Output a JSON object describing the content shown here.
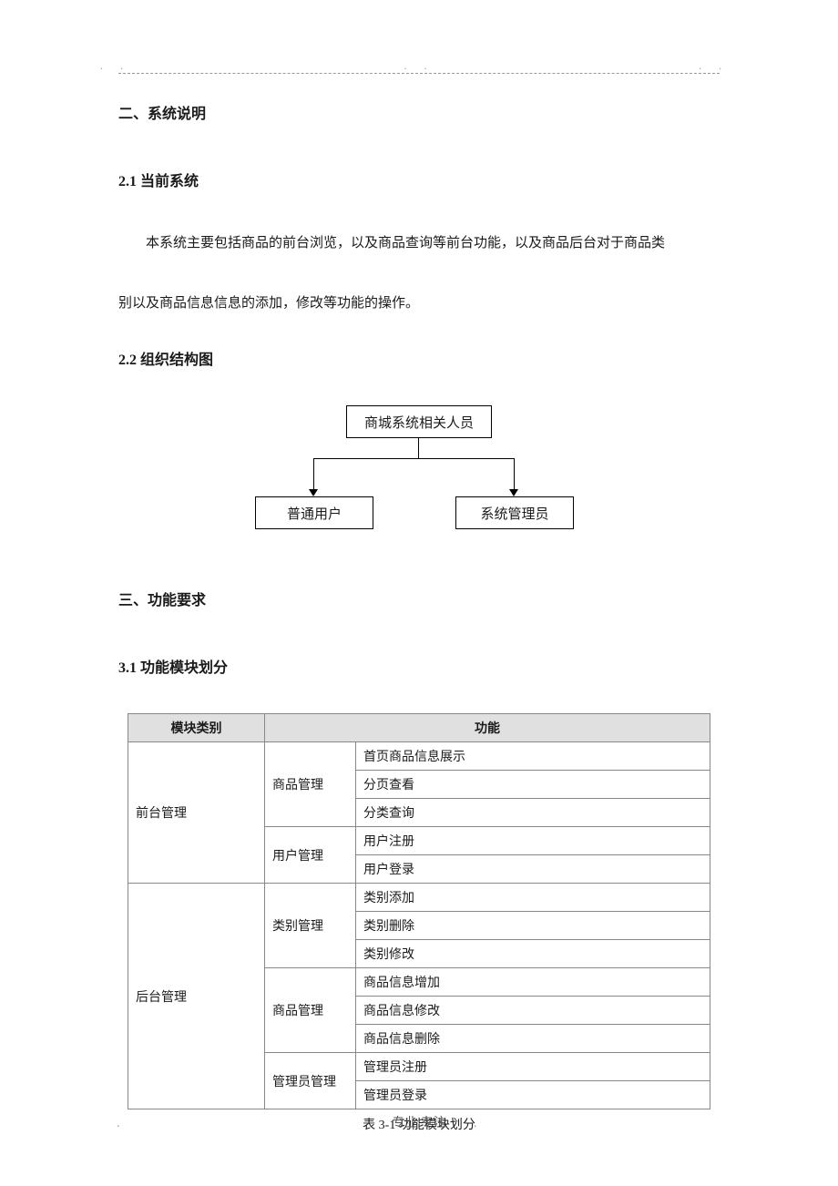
{
  "sections": {
    "s2": "二、系统说明",
    "s21": "2.1 当前系统",
    "s21_p1": "本系统主要包括商品的前台浏览，以及商品查询等前台功能，以及商品后台对于商品类",
    "s21_p2": "别以及商品信息信息的添加，修改等功能的操作。",
    "s22": "2.2 组织结构图",
    "s3": "三、功能要求",
    "s31": "3.1 功能模块划分"
  },
  "org": {
    "top": "商城系统相关人员",
    "left": "普通用户",
    "right": "系统管理员"
  },
  "table": {
    "headers": {
      "module": "模块类别",
      "func": "功能"
    },
    "rows": [
      {
        "module": "前台管理",
        "sub": "商品管理",
        "func": "首页商品信息展示"
      },
      {
        "module": "",
        "sub": "",
        "func": "分页查看"
      },
      {
        "module": "",
        "sub": "",
        "func": "分类查询"
      },
      {
        "module": "",
        "sub": "用户管理",
        "func": "用户注册"
      },
      {
        "module": "",
        "sub": "",
        "func": "用户登录"
      },
      {
        "module": "后台管理",
        "sub": "类别管理",
        "func": "类别添加"
      },
      {
        "module": "",
        "sub": "",
        "func": "类别删除"
      },
      {
        "module": "",
        "sub": "",
        "func": "类别修改"
      },
      {
        "module": "",
        "sub": "商品管理",
        "func": "商品信息增加"
      },
      {
        "module": "",
        "sub": "",
        "func": "商品信息修改"
      },
      {
        "module": "",
        "sub": "",
        "func": "商品信息删除"
      },
      {
        "module": "",
        "sub": "管理员管理",
        "func": "管理员注册"
      },
      {
        "module": "",
        "sub": "",
        "func": "管理员登录"
      }
    ],
    "caption": "表 3-1 功能模块划分"
  },
  "footer": "专业.专注"
}
